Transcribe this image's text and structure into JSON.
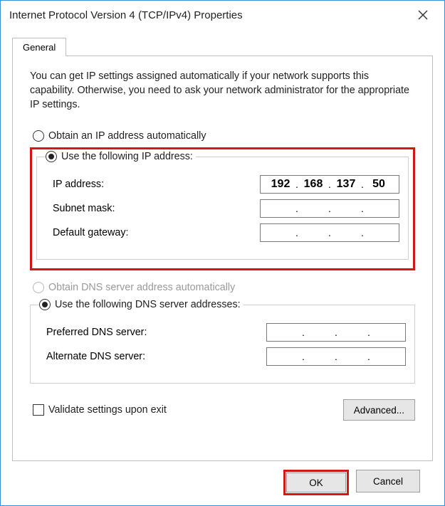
{
  "title": "Internet Protocol Version 4 (TCP/IPv4) Properties",
  "tab": {
    "general": "General"
  },
  "desc": "You can get IP settings assigned automatically if your network supports this capability. Otherwise, you need to ask your network administrator for the appropriate IP settings.",
  "ip_mode": {
    "auto": "Obtain an IP address automatically",
    "manual": "Use the following IP address:"
  },
  "ip_fields": {
    "ip_label": "IP address:",
    "ip_value": {
      "o1": "192",
      "o2": "168",
      "o3": "137",
      "o4": "50"
    },
    "subnet_label": "Subnet mask:",
    "gateway_label": "Default gateway:"
  },
  "dns_mode": {
    "auto": "Obtain DNS server address automatically",
    "manual": "Use the following DNS server addresses:"
  },
  "dns_fields": {
    "preferred_label": "Preferred DNS server:",
    "alternate_label": "Alternate DNS server:"
  },
  "validate": "Validate settings upon exit",
  "buttons": {
    "advanced": "Advanced...",
    "ok": "OK",
    "cancel": "Cancel"
  },
  "dot": "."
}
